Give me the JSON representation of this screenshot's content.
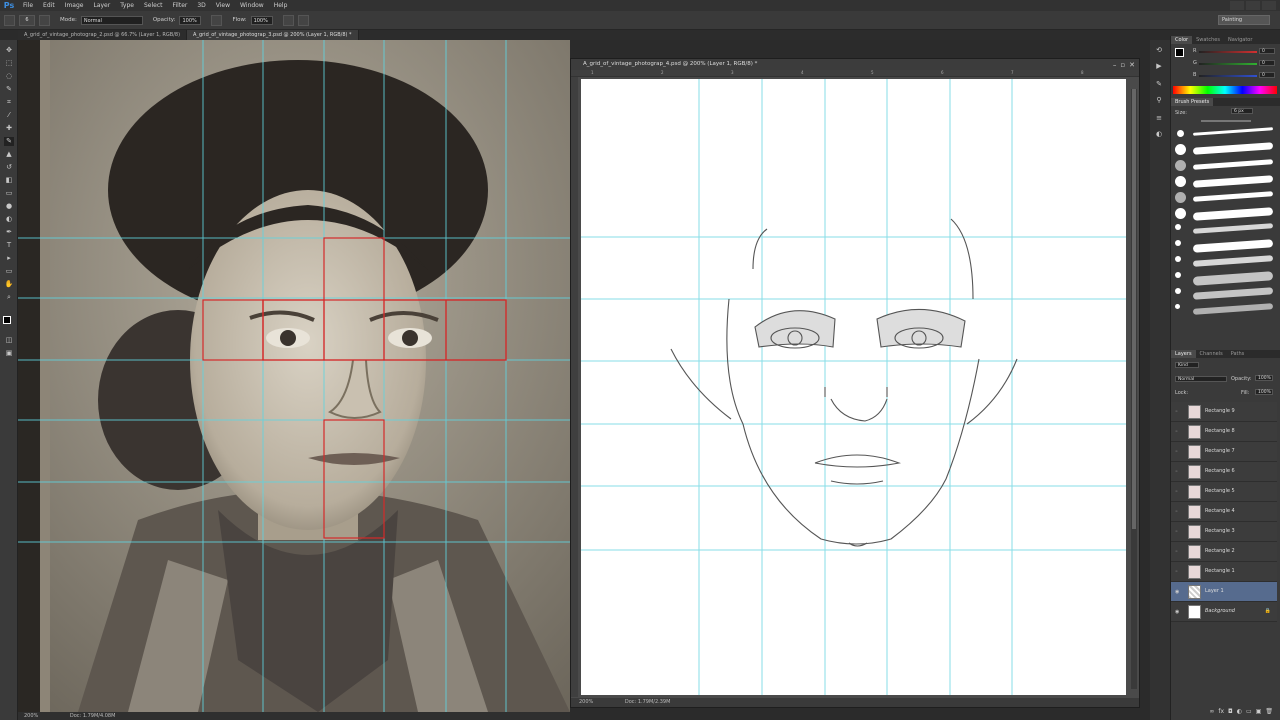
{
  "app": {
    "logo": "Ps"
  },
  "menu": [
    "File",
    "Edit",
    "Image",
    "Layer",
    "Type",
    "Select",
    "Filter",
    "3D",
    "View",
    "Window",
    "Help"
  ],
  "options": {
    "mode_label": "Mode:",
    "mode_value": "Normal",
    "opacity_label": "Opacity:",
    "opacity_value": "100%",
    "flow_label": "Flow:",
    "flow_value": "100%",
    "brush_size_value": "6",
    "workspace": "Painting"
  },
  "doc_tabs": [
    "A_grid_of_vintage_photograp_2.psd @ 66.7% (Layer 1, RGB/8)",
    "A_grid_of_vintage_photograp_3.psd @ 200% (Layer 1, RGB/8) *"
  ],
  "left_doc": {
    "zoom": "200%",
    "doc_size": "Doc: 1.79M/4.08M"
  },
  "floating_doc": {
    "title": "A_grid_of_vintage_photograp_4.psd @ 200% (Layer 1, RGB/8) *",
    "zoom": "200%",
    "doc_size": "Doc: 1.79M/2.39M",
    "ruler_marks": [
      "1",
      "2",
      "3",
      "4",
      "5",
      "6",
      "7",
      "8"
    ]
  },
  "color_panel": {
    "tabs": [
      "Color",
      "Swatches",
      "Navigator"
    ],
    "channels": [
      {
        "label": "R",
        "value": "0",
        "color": "#d03030"
      },
      {
        "label": "G",
        "value": "0",
        "color": "#30b030"
      },
      {
        "label": "B",
        "value": "0",
        "color": "#3050d0"
      }
    ]
  },
  "brush_panel": {
    "title": "Brush Presets",
    "size_label": "Size:",
    "size_value": "6 px"
  },
  "layers_panel": {
    "tabs": [
      "Layers",
      "Channels",
      "Paths"
    ],
    "filter_label": "Kind",
    "blend_mode": "Normal",
    "opacity_label": "Opacity:",
    "opacity_value": "100%",
    "lock_label": "Lock:",
    "fill_label": "Fill:",
    "fill_value": "100%",
    "layers": [
      {
        "name": "Rectangle 9"
      },
      {
        "name": "Rectangle 8"
      },
      {
        "name": "Rectangle 7"
      },
      {
        "name": "Rectangle 6"
      },
      {
        "name": "Rectangle 5"
      },
      {
        "name": "Rectangle 4"
      },
      {
        "name": "Rectangle 3"
      },
      {
        "name": "Rectangle 2"
      },
      {
        "name": "Rectangle 1"
      },
      {
        "name": "Layer 1",
        "selected": true
      },
      {
        "name": "Background"
      }
    ]
  },
  "colors": {
    "guide": "#5fd4e0",
    "red_box": "#d42a2a",
    "selection": "#566b8e"
  }
}
